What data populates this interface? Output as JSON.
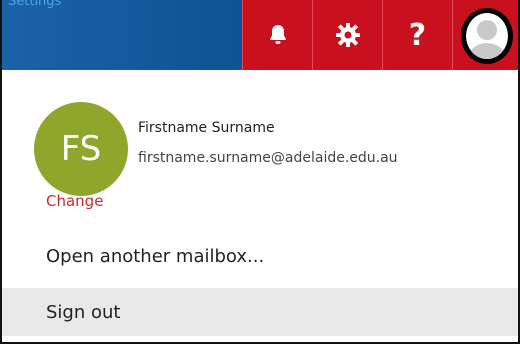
{
  "header": {
    "top_link_text": "Settings",
    "icons": {
      "bell": "bell-icon",
      "gear": "gear-icon",
      "help": "?",
      "avatar": "avatar-icon"
    }
  },
  "profile": {
    "initials": "FS",
    "change_label": "Change",
    "name": "Firstname Surname",
    "email": "firstname.surname@adelaide.edu.au"
  },
  "menu": {
    "open_mailbox": "Open another mailbox...",
    "sign_out": "Sign out"
  },
  "colors": {
    "topbar_blue": "#0f5596",
    "icon_red": "#c8101e",
    "avatar_green": "#8da62b",
    "change_red": "#cc2a2a",
    "hover_gray": "#e9e9e9"
  }
}
